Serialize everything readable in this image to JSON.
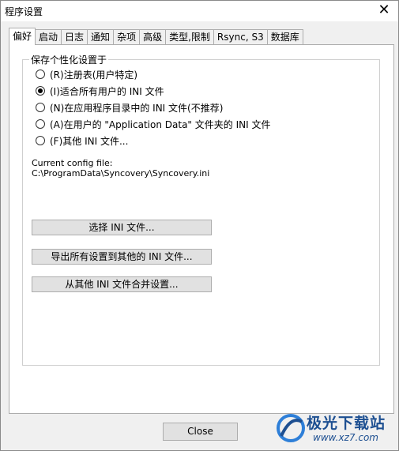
{
  "window": {
    "title": "程序设置"
  },
  "tabs": [
    {
      "label": "偏好",
      "active": true
    },
    {
      "label": "启动"
    },
    {
      "label": "日志"
    },
    {
      "label": "通知"
    },
    {
      "label": "杂项"
    },
    {
      "label": "高级"
    },
    {
      "label": "类型,限制"
    },
    {
      "label": "Rsync, S3"
    },
    {
      "label": "数据库"
    }
  ],
  "group": {
    "title": "保存个性化设置于",
    "options": [
      {
        "label": "(R)注册表(用户特定)",
        "checked": false
      },
      {
        "label": "(I)适合所有用户的 INI 文件",
        "checked": true
      },
      {
        "label": "(N)在应用程序目录中的 INI 文件(不推荐)",
        "checked": false
      },
      {
        "label": "(A)在用户的 \"Application Data\" 文件夹的 INI 文件",
        "checked": false
      },
      {
        "label": "(F)其他 INI 文件...",
        "checked": false
      }
    ],
    "config_label": "Current config file:",
    "config_path": "C:\\ProgramData\\Syncovery\\Syncovery.ini",
    "buttons": {
      "choose": "选择 INI 文件...",
      "export": "导出所有设置到其他的 INI 文件...",
      "merge": "从其他 INI 文件合并设置..."
    }
  },
  "footer": {
    "close": "Close"
  },
  "watermark": {
    "text": "极光下载站",
    "url": "www.xz7.com",
    "colors": {
      "primary": "#1d4f91",
      "accent": "#2e7fd8"
    }
  }
}
